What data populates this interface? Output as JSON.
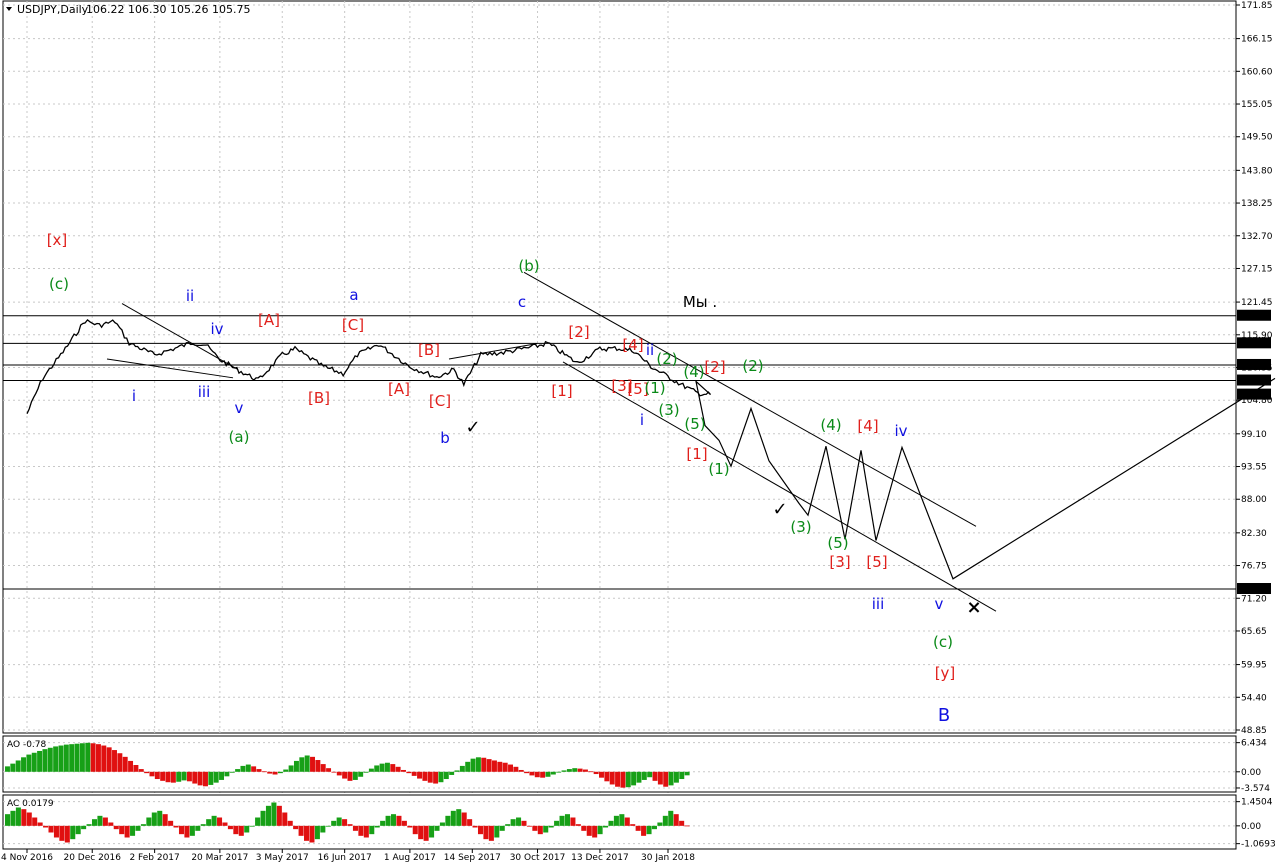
{
  "header": {
    "symbol": "USDJPY,Daily",
    "ohlc": "106.22 106.30 105.26 105.75"
  },
  "colors": {
    "red": "#e0201c",
    "green": "#0a8a18",
    "blue": "#1010e0",
    "black": "#000000",
    "ao_up": "#17a017",
    "ao_down": "#e01010"
  },
  "chart_data": [
    {
      "type": "line",
      "panel": "price",
      "y_ticks": [
        "171.85",
        "166.15",
        "160.60",
        "155.05",
        "149.50",
        "143.80",
        "138.25",
        "132.70",
        "127.15",
        "121.45",
        "115.90",
        "110.35",
        "104.80",
        "99.10",
        "93.55",
        "88.00",
        "82.30",
        "76.75",
        "71.20",
        "65.65",
        "59.95",
        "54.40",
        "48.85"
      ],
      "x_ticks": [
        "4 Nov 2016",
        "20 Dec 2016",
        "2 Feb 2017",
        "20 Mar 2017",
        "3 May 2017",
        "16 Jun 2017",
        "1 Aug 2017",
        "14 Sep 2017",
        "30 Oct 2017",
        "13 Dec 2017",
        "30 Jan 2018"
      ],
      "price_boxes": [
        "119.13",
        "114.45",
        "110.78",
        "108.14",
        "105.75",
        "72.77"
      ],
      "price_path": [
        [
          "4 Nov 2016",
          102.5
        ],
        [
          "15 Nov 2016",
          108.5
        ],
        [
          "1 Dec 2016",
          113.5
        ],
        [
          "15 Dec 2016",
          118.3
        ],
        [
          "25 Dec 2016",
          117.5
        ],
        [
          "5 Jan 2017",
          118.2
        ],
        [
          "15 Jan 2017",
          114.5
        ],
        [
          "2 Feb 2017",
          112.5
        ],
        [
          "15 Feb 2017",
          113.5
        ],
        [
          "1 Mar 2017",
          114.6
        ],
        [
          "10 Mar 2017",
          114.2
        ],
        [
          "20 Mar 2017",
          111.7
        ],
        [
          "1 Apr 2017",
          110.0
        ],
        [
          "16 Apr 2017",
          108.2
        ],
        [
          "3 May 2017",
          112.5
        ],
        [
          "12 May 2017",
          113.5
        ],
        [
          "1 Jun 2017",
          110.5
        ],
        [
          "15 Jun 2017",
          109.3
        ],
        [
          "25 Jun 2017",
          112.5
        ],
        [
          "10 Jul 2017",
          114.3
        ],
        [
          "1 Aug 2017",
          110.5
        ],
        [
          "20 Aug 2017",
          108.7
        ],
        [
          "1 Sep 2017",
          110.0
        ],
        [
          "8 Sep 2017",
          107.5
        ],
        [
          "20 Sep 2017",
          112.5
        ],
        [
          "6 Oct 2017",
          112.9
        ],
        [
          "30 Oct 2017",
          114.0
        ],
        [
          "6 Nov 2017",
          114.5
        ],
        [
          "27 Nov 2017",
          111.1
        ],
        [
          "13 Dec 2017",
          113.5
        ],
        [
          "25 Dec 2017",
          113.6
        ],
        [
          "6 Jan 2018",
          113.2
        ],
        [
          "18 Jan 2018",
          110.5
        ],
        [
          "30 Jan 2018",
          108.8
        ],
        [
          "8 Feb 2018",
          107.5
        ],
        [
          "20 Feb 2018",
          106.0
        ],
        [
          "1 Mar 2018",
          105.75
        ]
      ],
      "projection_path": [
        [
          "1 Mar 2018",
          105.75
        ],
        [
          696,
          108
        ],
        [
          705,
          100.5
        ],
        [
          719,
          98
        ],
        [
          731,
          93.6
        ],
        [
          751,
          103.4
        ],
        [
          769,
          94.5
        ],
        [
          799,
          87.3
        ],
        [
          808,
          85.3
        ],
        [
          826,
          97.0
        ],
        [
          845,
          81.2
        ],
        [
          861,
          96.3
        ],
        [
          876,
          81.0
        ],
        [
          902,
          96.8
        ],
        [
          953,
          74.5
        ],
        [
          1275,
          108.5
        ]
      ],
      "channel_lines": [
        {
          "from": [
            524,
            126.5
          ],
          "to": [
            976,
            83.4
          ]
        },
        {
          "from": [
            563,
            111.3
          ],
          "to": [
            996,
            69.0
          ]
        },
        {
          "from": [
            122,
            121.2
          ],
          "to": [
            238,
            110.0
          ]
        },
        {
          "from": [
            107,
            111.8
          ],
          "to": [
            233,
            108.6
          ]
        },
        {
          "from": [
            449,
            111.8
          ],
          "to": [
            537,
            114.4
          ]
        }
      ],
      "labels": [
        {
          "text": "[x]",
          "color": "red",
          "pos": [
            57,
            240
          ]
        },
        {
          "text": "(c)",
          "color": "green",
          "pos": [
            59,
            284
          ]
        },
        {
          "text": "ii",
          "color": "blue",
          "pos": [
            190,
            296
          ]
        },
        {
          "text": "iv",
          "color": "blue",
          "pos": [
            217,
            329
          ]
        },
        {
          "text": "i",
          "color": "blue",
          "pos": [
            134,
            396
          ]
        },
        {
          "text": "iii",
          "color": "blue",
          "pos": [
            204,
            392
          ]
        },
        {
          "text": "v",
          "color": "blue",
          "pos": [
            239,
            408
          ]
        },
        {
          "text": "(a)",
          "color": "green",
          "pos": [
            239,
            437
          ]
        },
        {
          "text": "[A]",
          "color": "red",
          "pos": [
            269,
            320
          ]
        },
        {
          "text": "[B]",
          "color": "red",
          "pos": [
            319,
            398
          ]
        },
        {
          "text": "a",
          "color": "blue",
          "pos": [
            354,
            295
          ]
        },
        {
          "text": "[C]",
          "color": "red",
          "pos": [
            353,
            325
          ]
        },
        {
          "text": "[B]",
          "color": "red",
          "pos": [
            429,
            350
          ]
        },
        {
          "text": "[A]",
          "color": "red",
          "pos": [
            399,
            389
          ]
        },
        {
          "text": "[C]",
          "color": "red",
          "pos": [
            440,
            401
          ]
        },
        {
          "text": "b",
          "color": "blue",
          "pos": [
            445,
            438
          ]
        },
        {
          "text": "c",
          "color": "blue",
          "pos": [
            522,
            302
          ]
        },
        {
          "text": "(b)",
          "color": "green",
          "pos": [
            529,
            266
          ]
        },
        {
          "text": "[2]",
          "color": "red",
          "pos": [
            579,
            332
          ]
        },
        {
          "text": "[1]",
          "color": "red",
          "pos": [
            562,
            391
          ]
        },
        {
          "text": "[4]",
          "color": "red",
          "pos": [
            633,
            345
          ]
        },
        {
          "text": "[3]",
          "color": "red",
          "pos": [
            622,
            386
          ]
        },
        {
          "text": "[5]",
          "color": "red",
          "pos": [
            638,
            389
          ]
        },
        {
          "text": "(1)",
          "color": "green",
          "pos": [
            655,
            388
          ]
        },
        {
          "text": "(2)",
          "color": "green",
          "pos": [
            667,
            359
          ]
        },
        {
          "text": "ii",
          "color": "blue",
          "pos": [
            650,
            350
          ]
        },
        {
          "text": "(3)",
          "color": "green",
          "pos": [
            669,
            410
          ]
        },
        {
          "text": "(4)",
          "color": "green",
          "pos": [
            694,
            372
          ]
        },
        {
          "text": "[2]",
          "color": "red",
          "pos": [
            715,
            367
          ]
        },
        {
          "text": "(2)",
          "color": "green",
          "pos": [
            753,
            366
          ]
        },
        {
          "text": "(5)",
          "color": "green",
          "pos": [
            695,
            424
          ]
        },
        {
          "text": "i",
          "color": "blue",
          "pos": [
            642,
            420
          ]
        },
        {
          "text": "[1]",
          "color": "red",
          "pos": [
            697,
            454
          ]
        },
        {
          "text": "(1)",
          "color": "green",
          "pos": [
            719,
            469
          ]
        },
        {
          "text": "(3)",
          "color": "green",
          "pos": [
            801,
            527
          ]
        },
        {
          "text": "(4)",
          "color": "green",
          "pos": [
            831,
            425
          ]
        },
        {
          "text": "[4]",
          "color": "red",
          "pos": [
            868,
            426
          ]
        },
        {
          "text": "iv",
          "color": "blue",
          "pos": [
            901,
            431
          ]
        },
        {
          "text": "(5)",
          "color": "green",
          "pos": [
            838,
            543
          ]
        },
        {
          "text": "[3]",
          "color": "red",
          "pos": [
            840,
            562
          ]
        },
        {
          "text": "[5]",
          "color": "red",
          "pos": [
            877,
            562
          ]
        },
        {
          "text": "iii",
          "color": "blue",
          "pos": [
            878,
            604
          ]
        },
        {
          "text": "v",
          "color": "blue",
          "pos": [
            939,
            604
          ]
        },
        {
          "text": "(c)",
          "color": "green",
          "pos": [
            943,
            642
          ]
        },
        {
          "text": "[y]",
          "color": "red",
          "pos": [
            945,
            673
          ]
        },
        {
          "text": "B",
          "color": "blue",
          "pos": [
            944,
            716
          ]
        },
        {
          "text": "Мы .",
          "color": "black",
          "pos": [
            700,
            302
          ]
        }
      ],
      "marks": [
        {
          "symbol": "✓",
          "pos": [
            473,
            427
          ]
        },
        {
          "symbol": "✓",
          "pos": [
            780,
            509
          ]
        },
        {
          "symbol": "×",
          "pos": [
            974,
            607
          ]
        }
      ]
    },
    {
      "type": "bar",
      "panel": "AO",
      "title": "AO -0.78",
      "y_ticks": [
        "6.434",
        "0.00",
        "-3.574"
      ],
      "description": "Awesome Oscillator histogram; green = rising bar, red = falling bar",
      "values": [
        1.2,
        1.8,
        2.5,
        3.2,
        3.8,
        4.2,
        4.6,
        5.0,
        5.3,
        5.6,
        5.8,
        6.0,
        6.1,
        6.2,
        6.3,
        6.4,
        6.3,
        6.1,
        5.8,
        5.4,
        4.8,
        4.1,
        3.3,
        2.4,
        1.5,
        0.6,
        -0.3,
        -1.0,
        -1.6,
        -2.0,
        -2.3,
        -2.4,
        -2.2,
        -1.9,
        -2.1,
        -2.6,
        -3.0,
        -3.2,
        -2.9,
        -2.4,
        -1.8,
        -1.0,
        -0.2,
        0.6,
        1.3,
        1.6,
        1.2,
        0.6,
        0.1,
        -0.4,
        -0.6,
        -0.3,
        0.5,
        1.4,
        2.4,
        3.2,
        3.6,
        3.3,
        2.6,
        1.7,
        0.8,
        0.0,
        -0.8,
        -1.5,
        -2.0,
        -1.8,
        -1.1,
        -0.2,
        0.7,
        1.4,
        1.8,
        2.0,
        1.7,
        1.1,
        0.4,
        -0.3,
        -0.9,
        -1.5,
        -2.0,
        -2.4,
        -2.6,
        -2.3,
        -1.6,
        -0.7,
        0.3,
        1.3,
        2.2,
        2.9,
        3.2,
        3.1,
        2.8,
        2.5,
        2.2,
        2.0,
        1.6,
        1.1,
        0.4,
        -0.3,
        -0.8,
        -1.2,
        -1.3,
        -1.1,
        -0.6,
        -0.1,
        0.3,
        0.6,
        0.8,
        0.7,
        0.5,
        0.1,
        -0.5,
        -1.3,
        -2.1,
        -2.8,
        -3.3,
        -3.5,
        -3.4,
        -3.0,
        -2.4,
        -1.8,
        -1.2,
        -2.0,
        -2.8,
        -3.3,
        -3.0,
        -2.4,
        -1.6,
        -0.78
      ]
    },
    {
      "type": "bar",
      "panel": "AC",
      "title": "AC 0.0179",
      "y_ticks": [
        "1.4504",
        "0.00",
        "-1.0693"
      ],
      "description": "Accelerator Oscillator histogram; green = rising bar, red = falling bar",
      "values": [
        0.7,
        0.9,
        1.1,
        1.0,
        0.8,
        0.5,
        0.2,
        -0.1,
        -0.4,
        -0.7,
        -0.9,
        -1.0,
        -0.8,
        -0.5,
        -0.2,
        0.1,
        0.4,
        0.6,
        0.5,
        0.2,
        -0.2,
        -0.5,
        -0.7,
        -0.6,
        -0.3,
        0.1,
        0.5,
        0.8,
        0.9,
        0.7,
        0.3,
        -0.1,
        -0.5,
        -0.7,
        -0.6,
        -0.3,
        0.1,
        0.4,
        0.6,
        0.5,
        0.2,
        -0.2,
        -0.5,
        -0.6,
        -0.4,
        0.0,
        0.5,
        0.9,
        1.2,
        1.4,
        1.2,
        0.8,
        0.3,
        -0.2,
        -0.6,
        -0.9,
        -1.0,
        -0.8,
        -0.4,
        0.0,
        0.3,
        0.5,
        0.4,
        0.1,
        -0.3,
        -0.6,
        -0.7,
        -0.5,
        -0.1,
        0.3,
        0.6,
        0.7,
        0.6,
        0.3,
        -0.1,
        -0.5,
        -0.8,
        -0.9,
        -0.7,
        -0.3,
        0.2,
        0.6,
        0.9,
        1.0,
        0.8,
        0.4,
        -0.1,
        -0.5,
        -0.8,
        -0.9,
        -0.7,
        -0.3,
        0.1,
        0.4,
        0.5,
        0.3,
        0.0,
        -0.3,
        -0.5,
        -0.4,
        -0.1,
        0.3,
        0.6,
        0.7,
        0.5,
        0.1,
        -0.3,
        -0.6,
        -0.7,
        -0.5,
        -0.1,
        0.3,
        0.6,
        0.7,
        0.5,
        0.1,
        -0.3,
        -0.6,
        -0.5,
        -0.2,
        0.2,
        0.6,
        0.9,
        0.7,
        0.3,
        0.0179
      ]
    }
  ]
}
